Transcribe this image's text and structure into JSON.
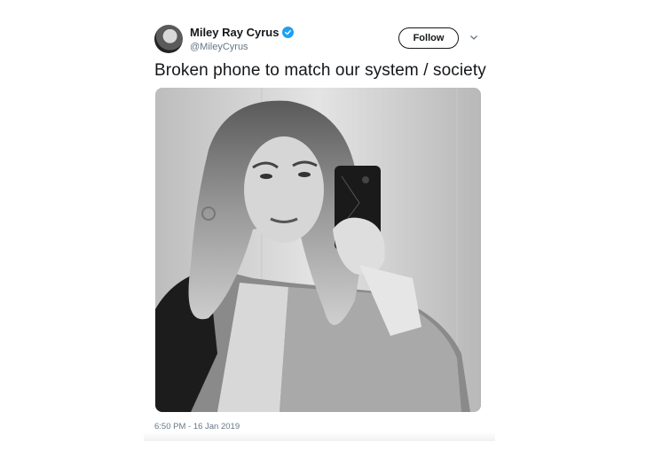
{
  "tweet": {
    "author": {
      "name": "Miley Ray Cyrus",
      "handle": "@MileyCyrus",
      "verified": true,
      "verified_icon": "verified-badge-icon",
      "verified_color": "#1da1f2"
    },
    "follow_label": "Follow",
    "more_icon": "chevron-down-icon",
    "text": "Broken phone to match our system / society",
    "photo_icon": "selfie-photo",
    "timestamp": "6:50 PM - 16 Jan 2019"
  }
}
